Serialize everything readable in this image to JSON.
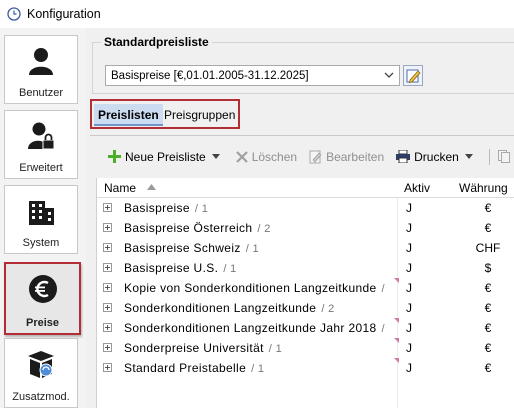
{
  "window": {
    "title": "Konfiguration"
  },
  "sidebar": {
    "items": [
      {
        "label": "Benutzer",
        "icon": "user-icon"
      },
      {
        "label": "Erweitert",
        "icon": "user-lock-icon"
      },
      {
        "label": "System",
        "icon": "building-icon"
      },
      {
        "label": "Preise",
        "icon": "euro-icon",
        "active": true
      },
      {
        "label": "Zusatzmod.",
        "icon": "module-box-icon"
      }
    ]
  },
  "standard_price_list": {
    "title": "Standardpreisliste",
    "selected": "Basispreise [€,01.01.2005-31.12.2025]"
  },
  "tabs": [
    {
      "label": "Preislisten",
      "selected": true
    },
    {
      "label": "Preisgruppen",
      "selected": false
    }
  ],
  "toolbar": {
    "new_label": "Neue Preisliste",
    "delete_label": "Löschen",
    "edit_label": "Bearbeiten",
    "print_label": "Drucken"
  },
  "grid": {
    "columns": {
      "name": "Name",
      "active": "Aktiv",
      "currency": "Währung"
    },
    "rows": [
      {
        "name": "Basispreise",
        "count": "/ 1",
        "active": "J",
        "currency": "€",
        "flag": false
      },
      {
        "name": "Basispreise Österreich",
        "count": "/ 2",
        "active": "J",
        "currency": "€",
        "flag": false
      },
      {
        "name": "Basispreise Schweiz",
        "count": "/ 1",
        "active": "J",
        "currency": "CHF",
        "flag": false
      },
      {
        "name": "Basispreise U.S.",
        "count": "/ 1",
        "active": "J",
        "currency": "$",
        "flag": false
      },
      {
        "name": "Kopie von Sonderkonditionen Langzeitkunde",
        "count": "/",
        "active": "J",
        "currency": "€",
        "flag": true
      },
      {
        "name": "Sonderkonditionen Langzeitkunde",
        "count": "/ 2",
        "active": "J",
        "currency": "€",
        "flag": false
      },
      {
        "name": "Sonderkonditionen Langzeitkunde Jahr 2018",
        "count": "/",
        "active": "J",
        "currency": "€",
        "flag": true
      },
      {
        "name": "Sonderpreise Universität",
        "count": "/ 1",
        "active": "J",
        "currency": "€",
        "flag": true
      },
      {
        "name": "Standard Preistabelle",
        "count": "/ 1",
        "active": "J",
        "currency": "€",
        "flag": true
      }
    ]
  },
  "colors": {
    "highlight_border": "#b22e34",
    "selected_tab": "#cbdcf0",
    "add_icon": "#4caf2a"
  }
}
